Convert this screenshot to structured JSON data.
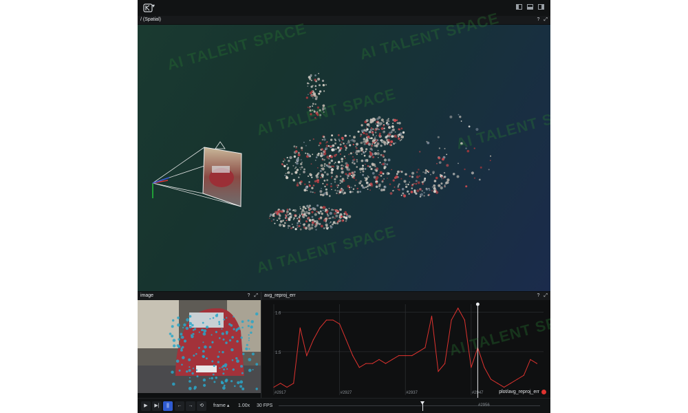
{
  "app": {
    "menu_caret": "▾",
    "layout_buttons": [
      "left-panel",
      "bottom-panel",
      "right-panel"
    ]
  },
  "spatial_panel": {
    "title": "/ (Spatial)",
    "help": "?",
    "expand": "⤢"
  },
  "image_panel": {
    "title": "image",
    "help": "?",
    "expand": "⤢"
  },
  "plot_panel": {
    "title": "avg_reproj_err",
    "help": "?",
    "expand": "⤢",
    "legend": "plot/avg_reproj_err",
    "legend_color": "#e0332f"
  },
  "chart_data": {
    "type": "line",
    "title": "avg_reproj_err",
    "xlabel": "",
    "ylabel": "",
    "y_ticks": [
      "1.6",
      "1.5"
    ],
    "x_ticks": [
      "#2917",
      "#2927",
      "#2937",
      "#2947",
      "#2956"
    ],
    "x_tick_values": [
      2917,
      2927,
      2937,
      2947,
      2956
    ],
    "grid": true,
    "line_color": "#e0332f",
    "cursor_x": 2948,
    "ylim": [
      1.39,
      1.62
    ],
    "xlim": [
      2917,
      2958
    ],
    "series": [
      {
        "name": "plot/avg_reproj_err",
        "x": [
          2917,
          2918,
          2919,
          2920,
          2921,
          2922,
          2923,
          2924,
          2925,
          2926,
          2927,
          2928,
          2929,
          2930,
          2931,
          2932,
          2933,
          2934,
          2935,
          2936,
          2937,
          2938,
          2939,
          2940,
          2941,
          2942,
          2943,
          2944,
          2945,
          2946,
          2947,
          2948,
          2949,
          2950,
          2951,
          2952,
          2953,
          2954,
          2955,
          2956,
          2957
        ],
        "y": [
          1.41,
          1.42,
          1.41,
          1.42,
          1.56,
          1.49,
          1.53,
          1.56,
          1.58,
          1.58,
          1.57,
          1.53,
          1.49,
          1.46,
          1.47,
          1.47,
          1.48,
          1.47,
          1.48,
          1.49,
          1.49,
          1.49,
          1.5,
          1.51,
          1.59,
          1.45,
          1.47,
          1.58,
          1.61,
          1.58,
          1.46,
          1.51,
          1.46,
          1.43,
          1.42,
          1.41,
          1.42,
          1.43,
          1.44,
          1.48,
          1.47
        ]
      }
    ]
  },
  "transport": {
    "play": "▶",
    "step": "▶|",
    "pause": "||",
    "prev": "←",
    "next": "→",
    "loop": "⟲",
    "timeline_name": "frame ▴",
    "speed": "1.00x",
    "fps": "30 FPS",
    "timeline_current": 0.55
  },
  "watermark": {
    "text": "AI TALENT SPACE"
  }
}
